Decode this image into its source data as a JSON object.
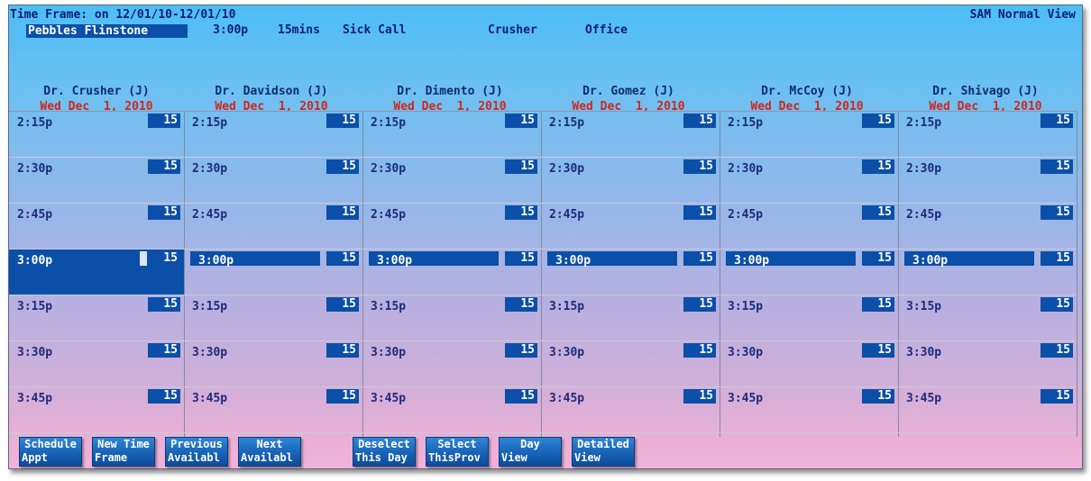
{
  "header": {
    "time_frame": "Time Frame: on 12/01/10-12/01/10",
    "view_name": "SAM Normal View",
    "patient": "Pebbles Flinstone",
    "appt_time": "3:00p",
    "appt_length": "15mins",
    "appt_reason": "Sick Call",
    "provider": "Crusher",
    "location": "Office"
  },
  "providers": [
    {
      "name": "Dr. Crusher (J)",
      "date": "Wed Dec  1, 2010"
    },
    {
      "name": "Dr. Davidson (J)",
      "date": "Wed Dec  1, 2010"
    },
    {
      "name": "Dr. Dimento (J)",
      "date": "Wed Dec  1, 2010"
    },
    {
      "name": "Dr. Gomez (J)",
      "date": "Wed Dec  1, 2010"
    },
    {
      "name": "Dr. McCoy (J)",
      "date": "Wed Dec  1, 2010"
    },
    {
      "name": "Dr. Shivago (J)",
      "date": "Wed Dec  1, 2010"
    }
  ],
  "slots": [
    "2:15p",
    "2:30p",
    "2:45p",
    "3:00p",
    "3:15p",
    "3:30p",
    "3:45p"
  ],
  "slot_duration": "15",
  "selected_slot": {
    "provider": "Dr. Crusher (J)",
    "time": "3:00p"
  },
  "highlighted_row": "3:00p",
  "buttons": [
    {
      "line1": "Schedule",
      "line2": "Appt"
    },
    {
      "line1": "New Time",
      "line2": "Frame"
    },
    {
      "line1": "Previous",
      "line2": "Availabl"
    },
    {
      "line1": "Next",
      "line2": "Availabl"
    },
    {
      "line1": "Deselect",
      "line2": "This Day"
    },
    {
      "line1": "Select",
      "line2": "ThisProv"
    },
    {
      "line1": "Day",
      "line2": "View"
    },
    {
      "line1": "Detailed",
      "line2": "View"
    }
  ],
  "colors": {
    "highlight": "#0b4fa8",
    "date_text": "#d3261e",
    "header_text": "#0d2c73"
  }
}
